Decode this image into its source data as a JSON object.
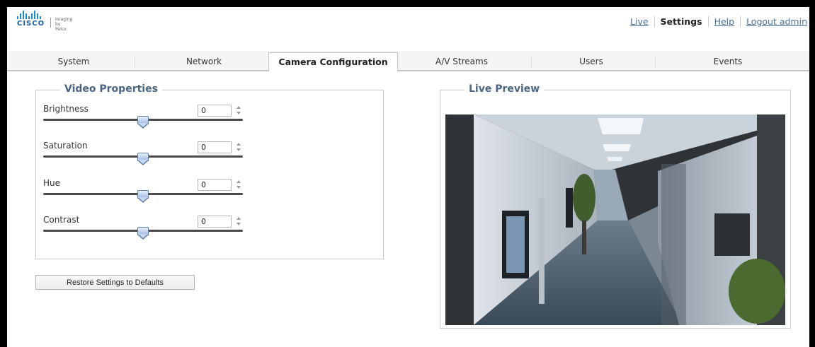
{
  "brand": {
    "logo_text": "CISCO",
    "sub_line1": "Imaging",
    "sub_line2": "by Pelco"
  },
  "topnav": {
    "live": "Live",
    "settings": "Settings",
    "help": "Help",
    "logout": "Logout admin"
  },
  "tabs": [
    {
      "label": "System"
    },
    {
      "label": "Network"
    },
    {
      "label": "Camera Configuration",
      "active": true
    },
    {
      "label": "A/V Streams"
    },
    {
      "label": "Users"
    },
    {
      "label": "Events"
    }
  ],
  "video_properties": {
    "legend": "Video Properties",
    "controls": [
      {
        "label": "Brightness",
        "value": "0",
        "level": 0.5
      },
      {
        "label": "Saturation",
        "value": "0",
        "level": 0.5
      },
      {
        "label": "Hue",
        "value": "0",
        "level": 0.5
      },
      {
        "label": "Contrast",
        "value": "0",
        "level": 0.5
      }
    ]
  },
  "restore_button": "Restore Settings to Defaults",
  "preview": {
    "legend": "Live Preview"
  },
  "colors": {
    "link": "#4a6f9a",
    "legend": "#4a6584",
    "accent": "#1a8fd0"
  }
}
